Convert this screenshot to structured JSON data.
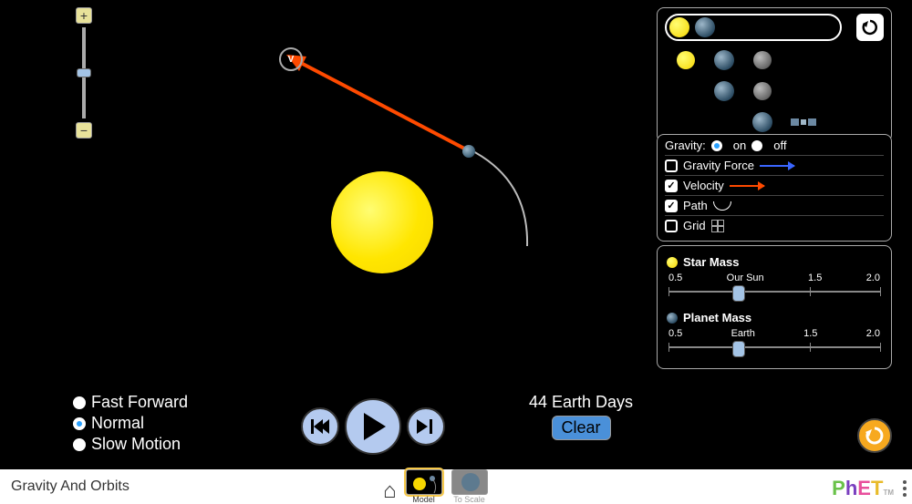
{
  "title": "Gravity And Orbits",
  "nav": {
    "home": "home",
    "model": "Model",
    "toscale": "To Scale"
  },
  "zoom": {
    "plus": "+",
    "minus": "−"
  },
  "velocity_label": "V",
  "speed": {
    "fast": "Fast Forward",
    "normal": "Normal",
    "slow": "Slow Motion",
    "selected": "normal"
  },
  "time": {
    "value": "44 Earth Days",
    "clear": "Clear"
  },
  "gravity": {
    "label": "Gravity:",
    "on": "on",
    "off": "off",
    "selected": "on"
  },
  "checks": {
    "gforce": "Gravity Force",
    "velocity": "Velocity",
    "path": "Path",
    "grid": "Grid"
  },
  "mass": {
    "star": {
      "label": "Star Mass",
      "ticks": [
        "0.5",
        "Our Sun",
        "1.5",
        "2.0"
      ],
      "value": 1.0,
      "range": [
        0.5,
        2.0
      ]
    },
    "planet": {
      "label": "Planet Mass",
      "ticks": [
        "0.5",
        "Earth",
        "1.5",
        "2.0"
      ],
      "value": 1.0,
      "range": [
        0.5,
        2.0
      ]
    }
  },
  "phet": {
    "p": "P",
    "h": "h",
    "e": "E",
    "t": "T",
    "tm": "TM"
  }
}
